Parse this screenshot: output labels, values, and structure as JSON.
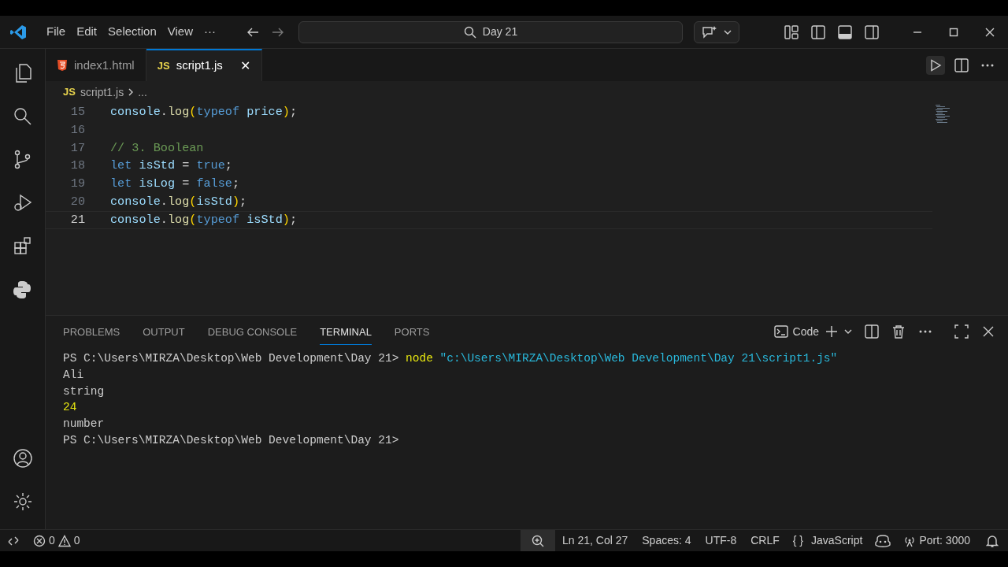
{
  "menu": [
    "File",
    "Edit",
    "Selection",
    "View",
    "···"
  ],
  "search": {
    "value": "Day 21"
  },
  "tabs": [
    {
      "label": "index1.html",
      "selected": false,
      "kind": "html"
    },
    {
      "label": "script1.js",
      "selected": true,
      "kind": "js",
      "icon_text": "JS",
      "close": "✕"
    }
  ],
  "breadcrumb": {
    "icon_text": "JS",
    "file": "script1.js",
    "more": "..."
  },
  "code_lines": [
    {
      "number": "15",
      "current": false,
      "tokens": [
        {
          "text": "console",
          "kind": "ident"
        },
        {
          "text": ".",
          "kind": "plain"
        },
        {
          "text": "log",
          "kind": "method"
        },
        {
          "text": "(",
          "kind": "paren"
        },
        {
          "text": "typeof",
          "kind": "keyword"
        },
        {
          "text": " price",
          "kind": "ident"
        },
        {
          "text": ")",
          "kind": "paren"
        },
        {
          "text": ";",
          "kind": "plain"
        }
      ]
    },
    {
      "number": "16",
      "current": false
    },
    {
      "number": "17",
      "current": false,
      "tokens": [
        {
          "text": "// 3. Boolean",
          "kind": "comment"
        }
      ]
    },
    {
      "number": "18",
      "current": false,
      "tokens": [
        {
          "text": "let",
          "kind": "keyword"
        },
        {
          "text": " isStd",
          "kind": "ident"
        },
        {
          "text": " = ",
          "kind": "plain"
        },
        {
          "text": "true",
          "kind": "keyword"
        },
        {
          "text": ";",
          "kind": "plain"
        }
      ]
    },
    {
      "number": "19",
      "current": false,
      "tokens": [
        {
          "text": "let",
          "kind": "keyword"
        },
        {
          "text": " isLog",
          "kind": "ident"
        },
        {
          "text": " = ",
          "kind": "plain"
        },
        {
          "text": "false",
          "kind": "keyword"
        },
        {
          "text": ";",
          "kind": "plain"
        }
      ]
    },
    {
      "number": "20",
      "current": false,
      "tokens": [
        {
          "text": "console",
          "kind": "ident"
        },
        {
          "text": ".",
          "kind": "plain"
        },
        {
          "text": "log",
          "kind": "method"
        },
        {
          "text": "(",
          "kind": "paren"
        },
        {
          "text": "isStd",
          "kind": "ident"
        },
        {
          "text": ")",
          "kind": "paren"
        },
        {
          "text": ";",
          "kind": "plain"
        }
      ]
    },
    {
      "number": "21",
      "current": true,
      "tokens": [
        {
          "text": "console",
          "kind": "ident"
        },
        {
          "text": ".",
          "kind": "plain"
        },
        {
          "text": "log",
          "kind": "method"
        },
        {
          "text": "(",
          "kind": "paren"
        },
        {
          "text": "typeof",
          "kind": "keyword"
        },
        {
          "text": " isStd",
          "kind": "ident"
        },
        {
          "text": ")",
          "kind": "paren"
        },
        {
          "text": ";",
          "kind": "plain"
        }
      ]
    }
  ],
  "panel_tabs": [
    {
      "label": "PROBLEMS",
      "selected": false
    },
    {
      "label": "OUTPUT",
      "selected": false
    },
    {
      "label": "DEBUG CONSOLE",
      "selected": false
    },
    {
      "label": "TERMINAL",
      "selected": true
    },
    {
      "label": "PORTS",
      "selected": false
    }
  ],
  "terminal": {
    "profile": "Code",
    "lines": [
      [
        {
          "text": "PS C:\\Users\\MIRZA\\Desktop\\Web Development\\Day 21> ",
          "kind": "plain"
        },
        {
          "text": "node",
          "kind": "command"
        },
        {
          "text": " \"c:\\Users\\MIRZA\\Desktop\\Web Development\\Day 21\\script1.js\"",
          "kind": "string"
        }
      ],
      [
        {
          "text": "Ali",
          "kind": "plain"
        }
      ],
      [
        {
          "text": "string",
          "kind": "plain"
        }
      ],
      [
        {
          "text": "24",
          "kind": "number"
        }
      ],
      [
        {
          "text": "number",
          "kind": "plain"
        }
      ],
      [
        {
          "text": "PS C:\\Users\\MIRZA\\Desktop\\Web Development\\Day 21>",
          "kind": "plain"
        }
      ]
    ]
  },
  "status": {
    "errors": "0",
    "warnings": "0",
    "position": "Ln 21, Col 27",
    "spaces": "Spaces: 4",
    "encoding": "UTF-8",
    "eol": "CRLF",
    "language_icon": "{ }",
    "language": "JavaScript",
    "port": "Port: 3000"
  }
}
